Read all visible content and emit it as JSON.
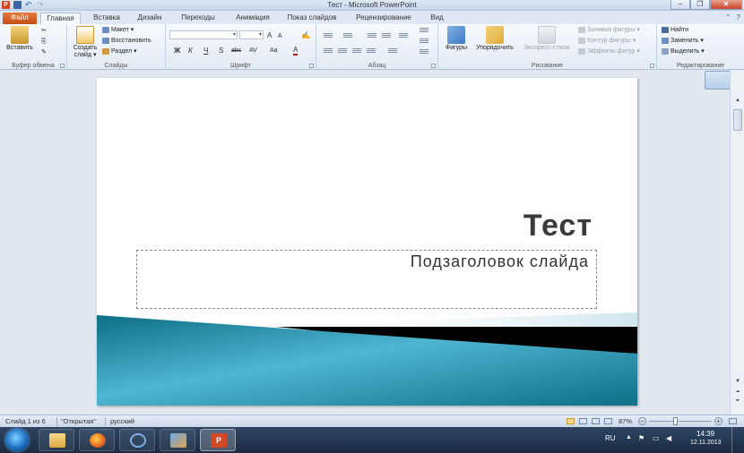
{
  "window": {
    "title": "Тест - Microsoft PowerPoint",
    "minimize": "–",
    "restore": "❐",
    "close": "✕"
  },
  "qat": {
    "app_icon": "P",
    "save_icon": "save-icon",
    "undo": "↶",
    "redo": "↷"
  },
  "tabs": [
    {
      "label": "Файл"
    },
    {
      "label": "Главная"
    },
    {
      "label": "Вставка"
    },
    {
      "label": "Дизайн"
    },
    {
      "label": "Переходы"
    },
    {
      "label": "Анимация"
    },
    {
      "label": "Показ слайдов"
    },
    {
      "label": "Рецензирование"
    },
    {
      "label": "Вид"
    }
  ],
  "help": {
    "minimize_ribbon": "⌃",
    "help": "?"
  },
  "ribbon": {
    "clipboard": {
      "label": "Буфер обмена",
      "paste": "Вставить",
      "cut": "✂",
      "copy": "⎘",
      "format_painter": "✎"
    },
    "slides": {
      "label": "Слайды",
      "new_slide_line1": "Создать",
      "new_slide_line2": "слайд ▾",
      "layout": "Макет ▾",
      "reset": "Восстановить",
      "section": "Раздел ▾"
    },
    "font": {
      "label": "Шрифт",
      "font_name": "",
      "font_size": "",
      "grow": "A",
      "shrink": "A",
      "clear": "✍",
      "bold": "Ж",
      "italic": "К",
      "underline": "Ч",
      "shadow": "S",
      "strike": "abc",
      "spacing": "AV",
      "case": "Aa",
      "color": "A"
    },
    "paragraph": {
      "label": "Абзац"
    },
    "drawing": {
      "label": "Рисование",
      "shapes": "Фигуры",
      "arrange": "Упорядочить",
      "quick_styles": "Экспресс-стили",
      "fill": "Заливка фигуры ▾",
      "outline": "Контур фигуры ▾",
      "effects": "Эффекты фигур ▾"
    },
    "editing": {
      "label": "Редактирование",
      "find": "Найти",
      "replace": "Заменить ▾",
      "select": "Выделить ▾"
    }
  },
  "slide": {
    "title": "Тест",
    "subtitle": "Подзаголовок слайда",
    "colors": {
      "teal_dark": "#0e6f86",
      "teal_light": "#4fb5d2",
      "band": "#000000"
    }
  },
  "statusbar": {
    "slide_info": "Слайд 1 из 6",
    "theme": "\"Открытая\"",
    "language": "русский",
    "zoom": "87%",
    "zoom_out": "–",
    "zoom_in": "+"
  },
  "taskbar": {
    "apps": [
      "explorer-icon",
      "firefox-icon",
      "media-icon",
      "people-icon",
      "powerpoint-icon"
    ],
    "language": "RU",
    "time": "14:39",
    "date": "12.11.2013"
  }
}
